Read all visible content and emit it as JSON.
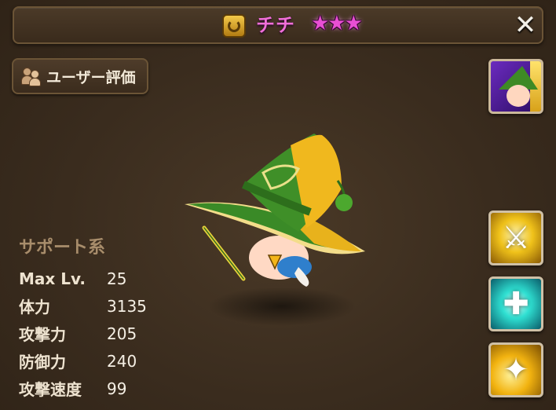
{
  "header": {
    "element_icon": "wind-element-icon",
    "monster_name": "チチ",
    "stars_text": "★★★",
    "star_count": 3,
    "close_icon": "close-icon",
    "close_glyph": "✕"
  },
  "review_button": {
    "icon": "users-icon",
    "label": "ユーザー評価"
  },
  "monster": {
    "class_label": "サポート系",
    "stats": [
      {
        "name": "Max Lv.",
        "value": "25"
      },
      {
        "name": "体力",
        "value": "3135"
      },
      {
        "name": "攻撃力",
        "value": "205"
      },
      {
        "name": "防御力",
        "value": "240"
      },
      {
        "name": "攻撃速度",
        "value": "99"
      }
    ]
  },
  "sidebar": {
    "portrait_icon": "monster-portrait",
    "skills": [
      {
        "icon": "sword-strike-skill-icon",
        "glyph": "⚔"
      },
      {
        "icon": "heal-cross-skill-icon",
        "glyph": "✚"
      },
      {
        "icon": "golden-orb-skill-icon",
        "glyph": "✦"
      }
    ]
  },
  "colors": {
    "background": "#3a2c1e",
    "name_color": "#f06fd8",
    "star_color": "#e94fd4",
    "class_label_color": "#a88d6b"
  }
}
